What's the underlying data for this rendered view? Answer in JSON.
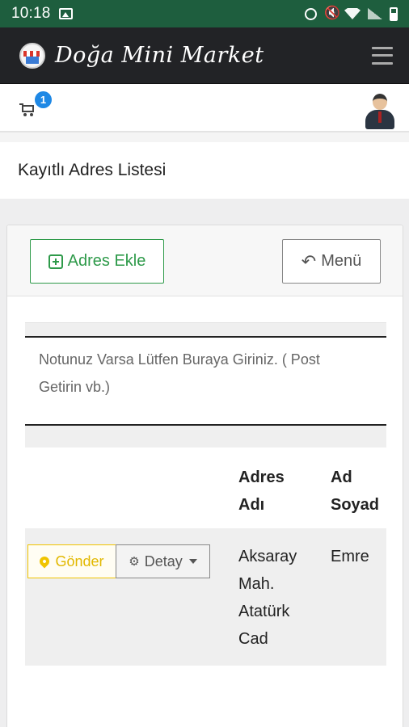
{
  "statusbar": {
    "time": "10:18",
    "icons": [
      "gallery-icon",
      "alarm-icon",
      "mute-icon",
      "wifi-icon",
      "signal-icon",
      "battery-icon"
    ]
  },
  "navbar": {
    "brand": "Doğa Mini Market",
    "logo_icon": "store-logo-icon",
    "menu_icon": "hamburger-icon",
    "background": "#222326"
  },
  "subbar": {
    "cart_icon": "cart-icon",
    "cart_count": "1",
    "avatar_icon": "user-avatar-icon"
  },
  "page": {
    "title": "Kayıtlı Adres Listesi"
  },
  "card": {
    "add_button_label": "Adres Ekle",
    "menu_button_label": "Menü",
    "note_text": "Notunuz Varsa Lütfen Buraya Giriniz. ( Post",
    "note_text_line2": "Getirin  vb.)",
    "table": {
      "headers": [
        "Adres Adı",
        "Ad Soyad"
      ],
      "header_lines": [
        [
          "Adres",
          "Adı"
        ],
        [
          "Ad",
          "Soyad"
        ]
      ],
      "rows": [
        {
          "send_label": "Gönder",
          "detail_label": "Detay",
          "address_lines": [
            "Aksaray",
            "Mah.",
            "Atatürk",
            "Cad"
          ],
          "name": "Emre"
        }
      ]
    }
  },
  "colors": {
    "statusbar": "#1e5e3e",
    "success": "#2e9a4a",
    "warning": "#f0c400",
    "badge": "#1e88e5"
  }
}
